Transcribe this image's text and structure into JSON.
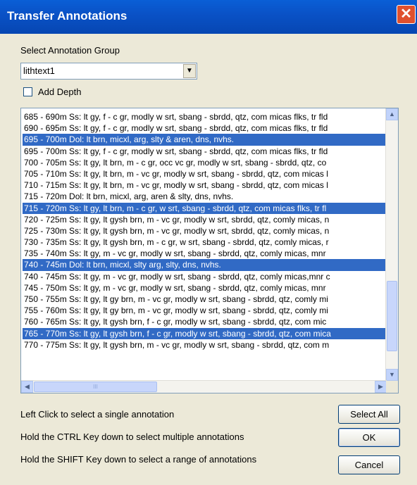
{
  "window": {
    "title": "Transfer Annotations",
    "close_symbol": "✕"
  },
  "group": {
    "label": "Select Annotation Group",
    "selected": "lithtext1",
    "dropdown_symbol": "▼"
  },
  "add_depth": {
    "label": "Add Depth",
    "checked": false
  },
  "annotations": [
    {
      "text": "685 - 690m Ss: lt gy, f - c gr, modly w srt, sbang - sbrdd, qtz, com micas flks, tr fld",
      "selected": false
    },
    {
      "text": "690 - 695m Ss: lt gy, f - c gr, modly w srt, sbang - sbrdd, qtz, com micas flks, tr fld",
      "selected": false
    },
    {
      "text": "695 - 700m Dol: lt brn, micxl, arg, slty & aren, dns, nvhs.",
      "selected": true
    },
    {
      "text": "695 - 700m Ss: lt gy, f - c gr, modly w srt, sbang - sbrdd, qtz, com micas flks, tr fld",
      "selected": false
    },
    {
      "text": "700 - 705m Ss: lt gy, lt brn, m - c gr, occ vc gr, modly w srt, sbang - sbrdd, qtz, co",
      "selected": false
    },
    {
      "text": "705 - 710m Ss: lt gy, lt brn, m - vc gr, modly w srt, sbang - sbrdd, qtz, com micas l",
      "selected": false
    },
    {
      "text": "710 - 715m Ss: lt gy, lt brn, m - vc gr, modly w srt, sbang - sbrdd, qtz, com micas l",
      "selected": false
    },
    {
      "text": "715 - 720m Dol: lt brn, micxl, arg, aren & slty, dns, nvhs.",
      "selected": false
    },
    {
      "text": "715 - 720m Ss: lt gy, lt brn, m - c gr, w srt, sbang - sbrdd, qtz, com micas flks, tr fl",
      "selected": true
    },
    {
      "text": "720 - 725m Ss: lt gy, lt gysh brn, m - vc gr, modly w srt, sbrdd, qtz, comly micas, n",
      "selected": false
    },
    {
      "text": "725 - 730m Ss: lt gy, lt gysh brn, m - vc gr, modly w srt, sbrdd, qtz, comly micas, n",
      "selected": false
    },
    {
      "text": "730 - 735m Ss: lt gy, lt gysh brn, m - c gr, w srt, sbang - sbrdd, qtz, comly micas, r",
      "selected": false
    },
    {
      "text": "735 - 740m Ss: lt gy, m - vc gr, modly w srt, sbang - sbrdd, qtz, comly micas, mnr",
      "selected": false
    },
    {
      "text": "740 - 745m Dol: lt brn, micxl, slty arg, slty, dns, nvhs.",
      "selected": true
    },
    {
      "text": "740 - 745m Ss: lt gy, m - vc gr, modly w srt, sbang - sbrdd, qtz, comly micas,mnr c",
      "selected": false
    },
    {
      "text": "745 - 750m Ss: lt gy, m - vc gr, modly w srt, sbang - sbrdd, qtz, comly micas, mnr",
      "selected": false
    },
    {
      "text": "750 - 755m Ss: lt gy, lt gy brn, m - vc gr, modly w srt, sbang - sbrdd, qtz, comly mi",
      "selected": false
    },
    {
      "text": "755 - 760m Ss: lt gy, lt gy brn, m - vc gr, modly w srt, sbang - sbrdd, qtz, comly mi",
      "selected": false
    },
    {
      "text": "760 - 765m Ss: lt gy, lt gysh brn, f - c gr, modly w srt, sbang - sbrdd, qtz, com mic",
      "selected": false
    },
    {
      "text": "765 - 770m Ss: lt gy, lt gysh brn, f - c gr, modly w srt, sbang - sbrdd, qtz, com mica",
      "selected": true
    },
    {
      "text": "770 - 775m Ss: lt gy, lt gysh brn, m - vc gr, modly w srt, sbang - sbrdd, qtz, com m",
      "selected": false
    }
  ],
  "scrollbars": {
    "up": "▲",
    "down": "▼",
    "left": "◀",
    "right": "▶",
    "grip": "III"
  },
  "instructions": {
    "left_click": "Left Click to select a single annotation",
    "ctrl": "Hold the CTRL Key down to select multiple annotations",
    "shift": "Hold the SHIFT Key down to select a range of annotations"
  },
  "buttons": {
    "select_all": "Select All",
    "ok": "OK",
    "cancel": "Cancel"
  },
  "colors": {
    "title_bar": "#0a52c7",
    "selection": "#316ac5",
    "dialog_bg": "#ece9d8"
  }
}
